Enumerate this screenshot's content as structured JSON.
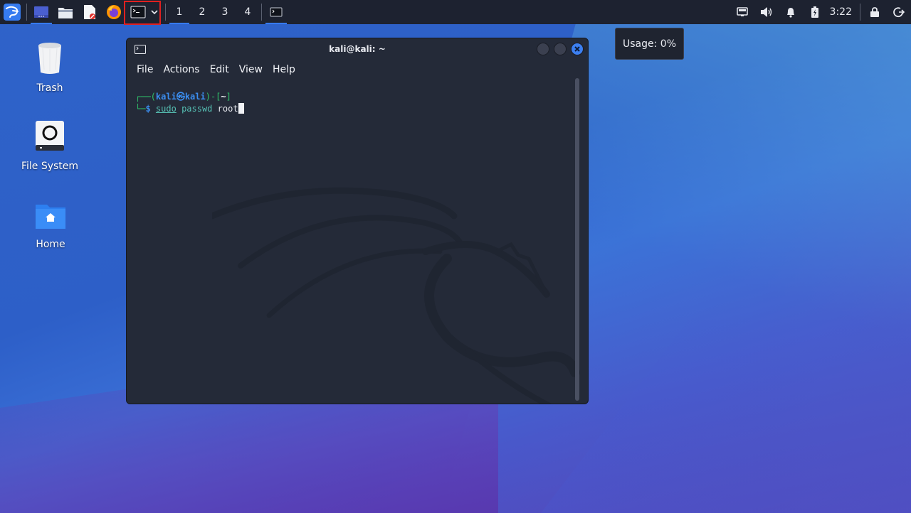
{
  "panel": {
    "workspaces": [
      "1",
      "2",
      "3",
      "4"
    ],
    "clock": "3:22"
  },
  "desktop": {
    "icons": [
      {
        "label": "Trash"
      },
      {
        "label": "File System"
      },
      {
        "label": "Home"
      }
    ]
  },
  "tooltip": {
    "text": "Usage: 0%"
  },
  "terminal": {
    "title": "kali@kali: ~",
    "menu": [
      "File",
      "Actions",
      "Edit",
      "View",
      "Help"
    ],
    "prompt": {
      "user": "kali",
      "at": "㉿",
      "host": "kali",
      "dir": "~",
      "symbol": "$",
      "command": "sudo",
      "arg1": "passwd",
      "arg2": "root"
    }
  },
  "colors": {
    "panel_bg": "#1d2230",
    "accent": "#367bf0",
    "terminal_bg": "#242a38",
    "highlight": "#e02020"
  }
}
